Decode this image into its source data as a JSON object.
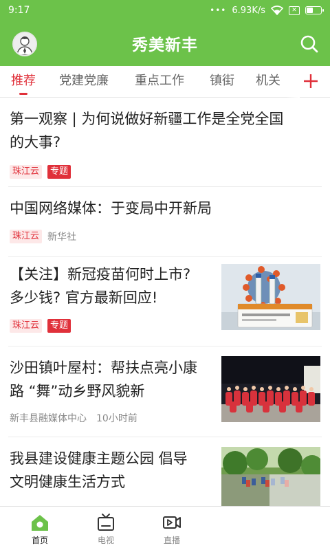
{
  "status_bar": {
    "time": "9:17",
    "dots": "•••",
    "net_speed": "6.93K/s"
  },
  "header": {
    "title": "秀美新丰",
    "avatar_icon": "user-avatar-icon",
    "search_icon": "search-icon",
    "color": "#6cc24a"
  },
  "tabs": {
    "items": [
      {
        "label": "推荐",
        "active": true
      },
      {
        "label": "党建党廉"
      },
      {
        "label": "重点工作"
      },
      {
        "label": "镇街"
      },
      {
        "label": "机关"
      }
    ],
    "add_icon": "plus-icon",
    "active_color": "#e0303a"
  },
  "feed": {
    "articles": [
      {
        "title_line1": "第一观察 | 为何说做好新疆工作是全党全国",
        "title_line2": "的大事?",
        "source_tag": "珠江云",
        "special_tag": "专题"
      },
      {
        "title_line1": "中国网络媒体：于变局中开新局",
        "source_tag": "珠江云",
        "source": "新华社"
      },
      {
        "title_line1": "【关注】新冠疫苗何时上市?",
        "title_line2": "多少钱? 官方最新回应!",
        "source_tag": "珠江云",
        "special_tag": "专题",
        "thumbnail": "vaccine-image"
      },
      {
        "title_line1": "沙田镇叶屋村：帮扶点亮小康",
        "title_line2": "路 “舞”动乡野风貌新",
        "source": "新丰县融媒体中心",
        "time": "10小时前",
        "thumbnail": "dance-group-image"
      },
      {
        "title_line1": "我县建设健康主题公园 倡导",
        "title_line2": "文明健康生活方式",
        "thumbnail": "park-image"
      }
    ]
  },
  "bottom_nav": {
    "items": [
      {
        "label": "首页",
        "icon": "home-icon",
        "active": true
      },
      {
        "label": "电视",
        "icon": "tv-icon"
      },
      {
        "label": "直播",
        "icon": "live-video-icon"
      }
    ],
    "active_color": "#6cc24a"
  }
}
